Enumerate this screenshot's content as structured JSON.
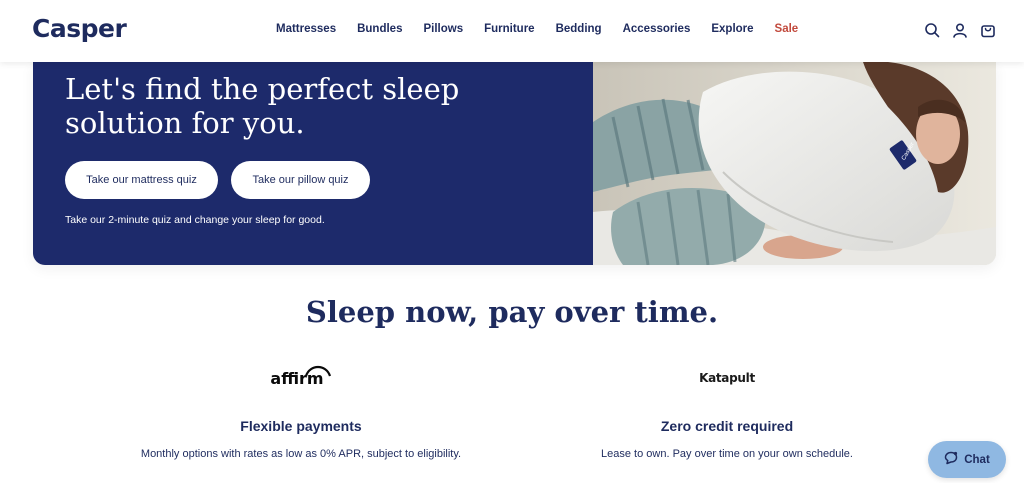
{
  "header": {
    "logo": "Casper",
    "nav": [
      "Mattresses",
      "Bundles",
      "Pillows",
      "Furniture",
      "Bedding",
      "Accessories",
      "Explore",
      "Sale"
    ],
    "icons": [
      "search-icon",
      "account-icon",
      "cart-icon"
    ]
  },
  "hero": {
    "title": "Let's find the perfect sleep solution for you.",
    "mattress_quiz_label": "Take our mattress quiz",
    "pillow_quiz_label": "Take our pillow quiz",
    "subtitle": "Take our 2-minute quiz and change your sleep for good.",
    "pillow_tag": "Casper"
  },
  "payments": {
    "title": "Sleep now, pay over time.",
    "options": [
      {
        "logo": "affirm",
        "heading": "Flexible payments",
        "description": "Monthly options with rates as low as 0% APR, subject to eligibility."
      },
      {
        "logo": "Katapult",
        "heading": "Zero credit required",
        "description": "Lease to own. Pay over time on your own schedule."
      }
    ]
  },
  "chat": {
    "label": "Chat"
  },
  "colors": {
    "navy": "#1e2b5e",
    "hero_bg": "#1d2a6b",
    "sale": "#c24a3d",
    "chat_bg": "#8fb8e2"
  }
}
